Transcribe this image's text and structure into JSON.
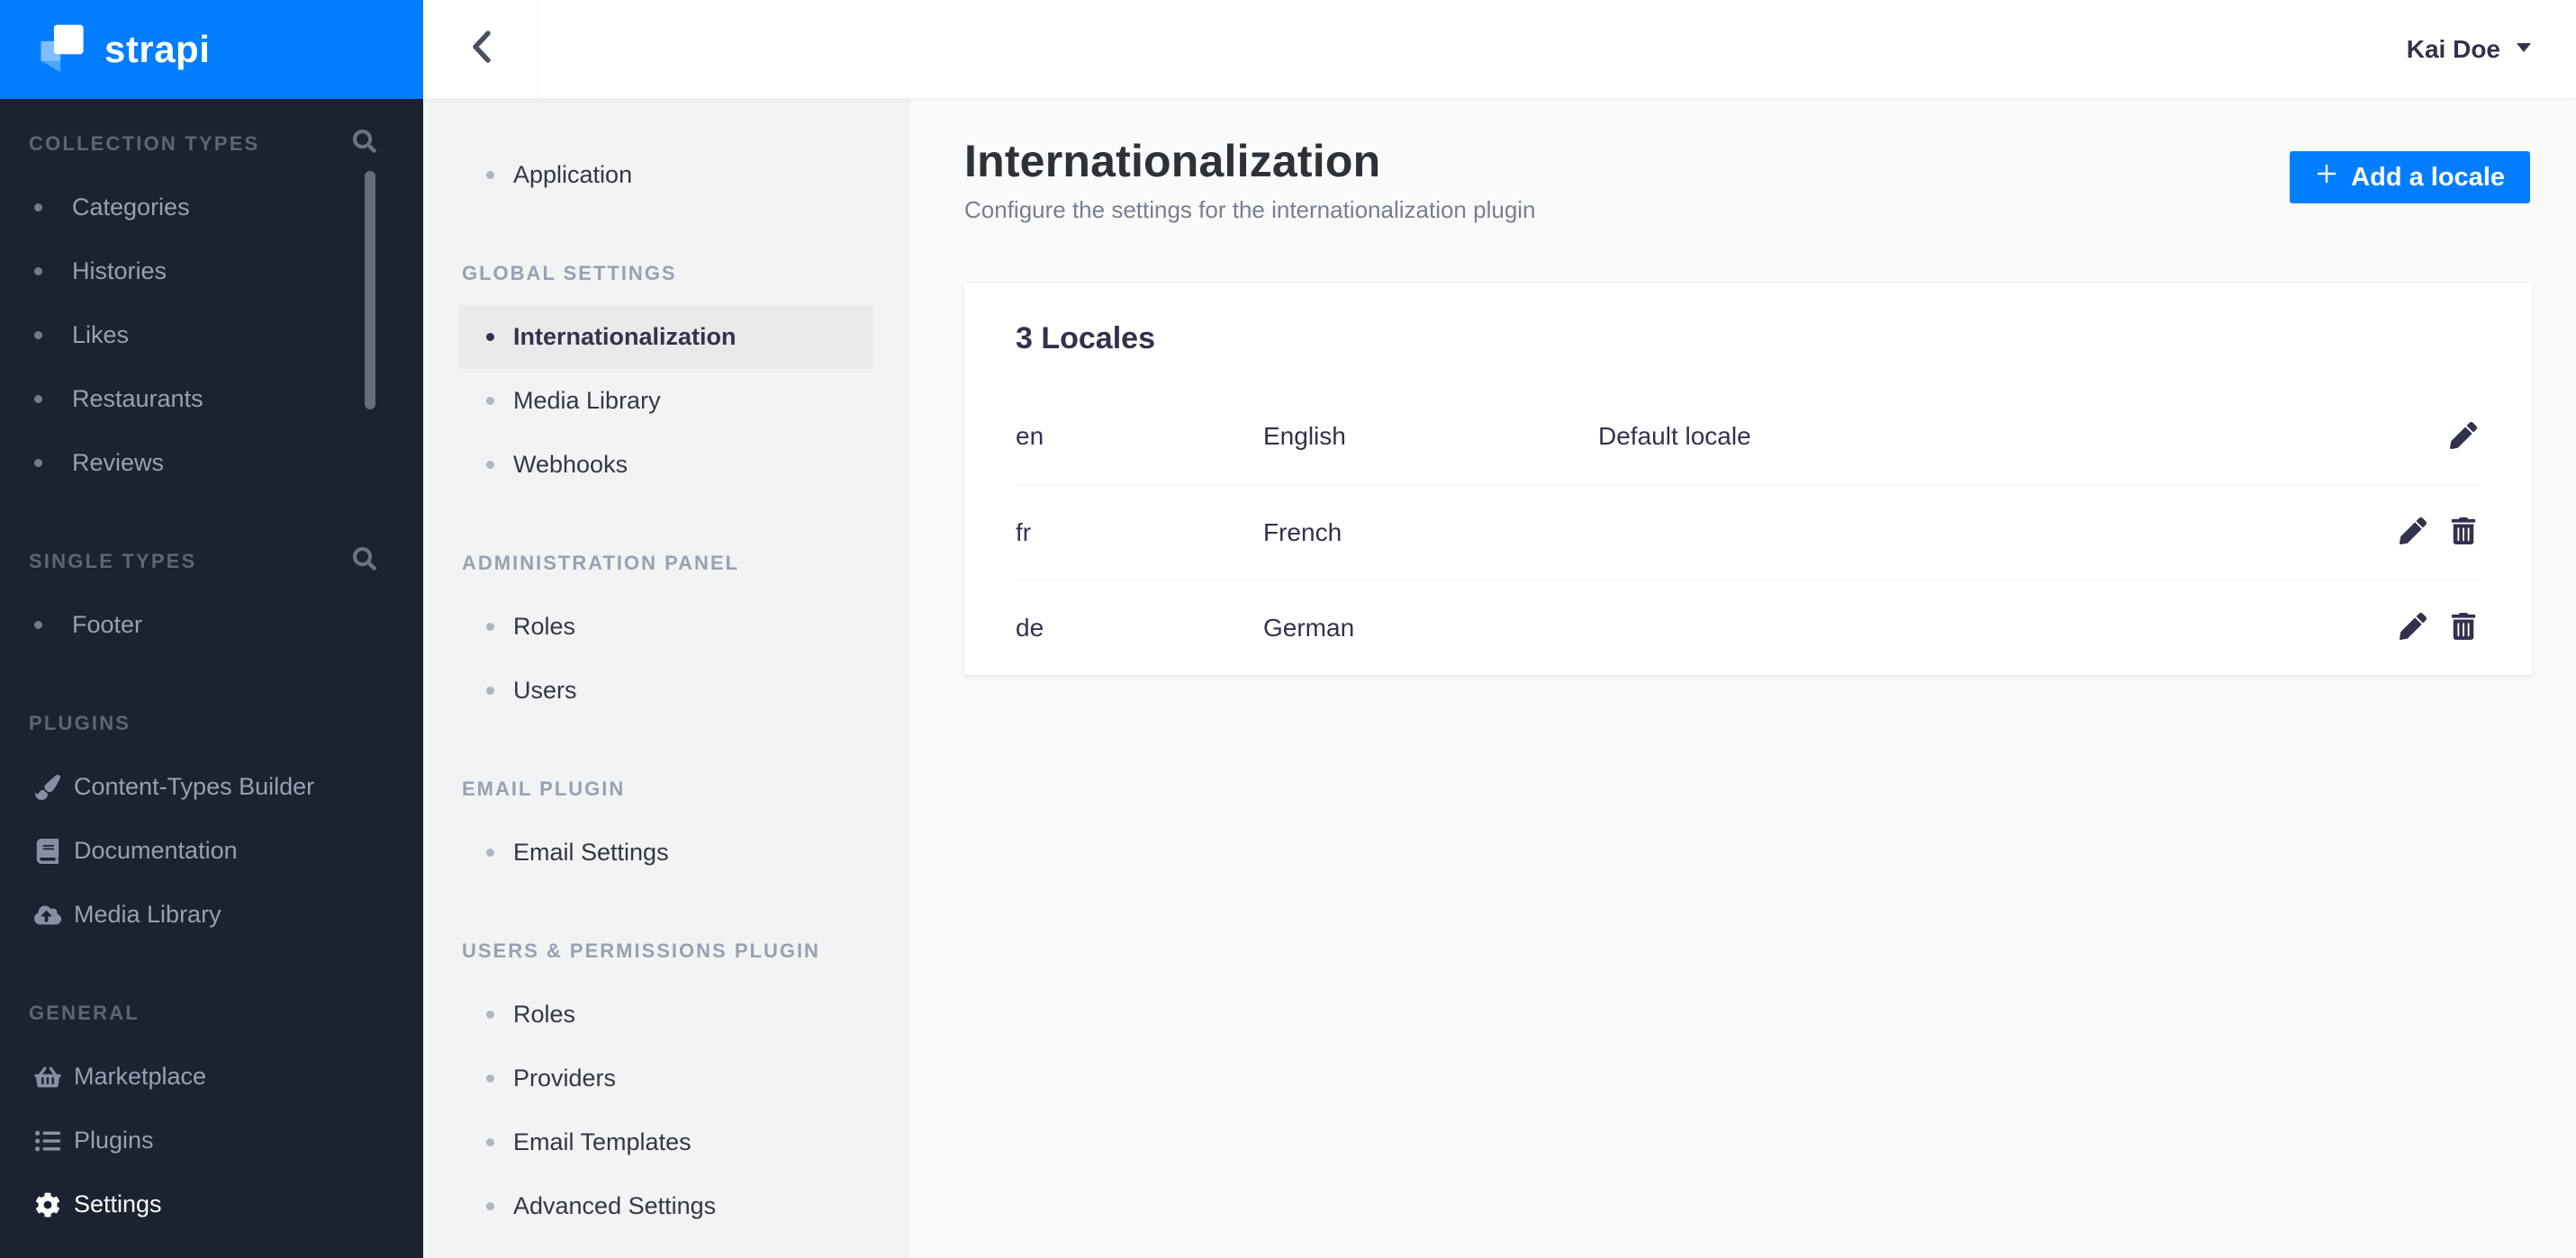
{
  "brand": {
    "name": "strapi",
    "accent_color": "#007eff",
    "sidebar_color": "#1b2230"
  },
  "header": {
    "user_name": "Kai Doe"
  },
  "side": {
    "sections": [
      {
        "label": "COLLECTION TYPES",
        "has_search": true,
        "items": [
          {
            "label": "Categories"
          },
          {
            "label": "Histories"
          },
          {
            "label": "Likes"
          },
          {
            "label": "Restaurants"
          },
          {
            "label": "Reviews"
          }
        ]
      },
      {
        "label": "SINGLE TYPES",
        "has_search": true,
        "items": [
          {
            "label": "Footer"
          }
        ]
      },
      {
        "label": "PLUGINS",
        "items": [
          {
            "label": "Content-Types Builder",
            "icon": "paint-brush-icon"
          },
          {
            "label": "Documentation",
            "icon": "book-icon"
          },
          {
            "label": "Media Library",
            "icon": "cloud-upload-icon"
          }
        ]
      },
      {
        "label": "GENERAL",
        "items": [
          {
            "label": "Marketplace",
            "icon": "shopping-basket-icon"
          },
          {
            "label": "Plugins",
            "icon": "list-icon"
          },
          {
            "label": "Settings",
            "icon": "gear-icon",
            "active": true
          }
        ]
      }
    ]
  },
  "settings_nav": {
    "sections": [
      {
        "label": "",
        "items": [
          {
            "label": "Application"
          }
        ]
      },
      {
        "label": "GLOBAL SETTINGS",
        "items": [
          {
            "label": "Internationalization",
            "active": true
          },
          {
            "label": "Media Library"
          },
          {
            "label": "Webhooks"
          }
        ]
      },
      {
        "label": "ADMINISTRATION PANEL",
        "items": [
          {
            "label": "Roles"
          },
          {
            "label": "Users"
          }
        ]
      },
      {
        "label": "EMAIL PLUGIN",
        "items": [
          {
            "label": "Email Settings"
          }
        ]
      },
      {
        "label": "USERS & PERMISSIONS PLUGIN",
        "items": [
          {
            "label": "Roles"
          },
          {
            "label": "Providers"
          },
          {
            "label": "Email Templates"
          },
          {
            "label": "Advanced Settings"
          }
        ]
      }
    ]
  },
  "main": {
    "title": "Internationalization",
    "subtitle": "Configure the settings for the internationalization plugin",
    "add_button_label": "Add a locale",
    "card": {
      "title": "3 Locales",
      "rows": [
        {
          "code": "en",
          "name": "English",
          "default_label": "Default locale",
          "can_delete": false
        },
        {
          "code": "fr",
          "name": "French",
          "default_label": "",
          "can_delete": true
        },
        {
          "code": "de",
          "name": "German",
          "default_label": "",
          "can_delete": true
        }
      ]
    }
  }
}
